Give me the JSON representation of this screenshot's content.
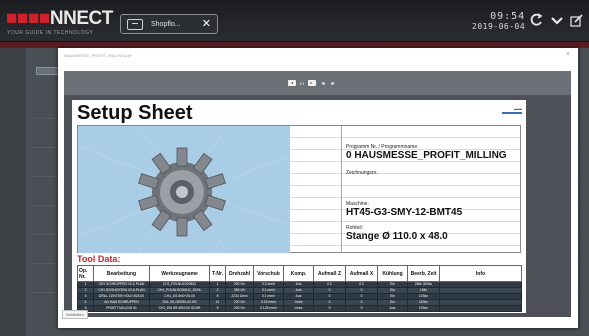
{
  "header": {
    "logo_red": "NNECT",
    "logo_red_prefix": "",
    "tagline": "YOUR GUIDE IN TECHNOLOGY",
    "tab_label": "Shopflo...",
    "tab_close": "✕",
    "time": "09:54",
    "date": "2019-06-04",
    "icons": [
      "refresh-icon",
      "chevron-down-icon",
      "edit-icon"
    ]
  },
  "modal": {
    "title": "HAUSMESSE_PROFIT_MILLING.pdf",
    "close": "×",
    "pager": {
      "prev": "◂",
      "page": "1/1",
      "next": "▸"
    },
    "close_button": "Schließen"
  },
  "sheet": {
    "title": "Setup Sheet",
    "program_label": "Programm Nr. / Programmname:",
    "program_value": "0 HAUSMESSE_PROFIT_MILLING",
    "drawing_label": "Zeichnungsnr.:",
    "machine_label": "Maschine:",
    "machine_value": "HT45-G3-SMY-12-BMT45",
    "stock_label": "Rohteil:",
    "stock_value": "Stange Ø 110.0 x  48.0",
    "tool_data_title": "Tool Data:"
  },
  "tool_table": {
    "headers": [
      "Op. Nr.",
      "Bearbeitung",
      "Werkzeugname",
      "T-Nr.",
      "Drehzahl",
      "Vorschub",
      "Komp.",
      "Aufmaß Z",
      "Aufmaß X",
      "Kühlung",
      "Beerb. Zeit",
      "Info"
    ],
    "rows": [
      [
        "1",
        "CH1 SCHRUPPEN V2 & PLAN",
        "CH1_POLNLSO20612",
        "1",
        "200 V/c",
        "0.2 mm/r",
        "Aus",
        "0.1",
        "0.2",
        "Ein",
        "2Min 30Sec",
        ""
      ],
      [
        "2",
        "CH1 SCHLICHTEN V2 & PLAN",
        "CH1_POLNLSO20612_SCHL",
        "2",
        "350 V/c",
        "0.1 mm/r",
        "Aus",
        "0",
        "0",
        "Ein",
        "1Min",
        ""
      ],
      [
        "3",
        "DRILL CENTER HOLE Ø25.00",
        "CH1_DS Ø40+25.00",
        "8",
        "2234 1/min",
        "0.1 mm/r",
        "Aus",
        "0",
        "0",
        "Ein",
        "10Sec",
        ""
      ],
      [
        "4",
        "AD HAM SCHRUPPEN",
        "SUL-XS-GRZ50-02-HS",
        "11",
        "220 V/c",
        "0.15 mm/r",
        "Links",
        "0",
        "0",
        "Ein",
        "11Sec",
        ""
      ],
      [
        "5",
        "PROFIT MILLING #1",
        "CH1_EM Ø4+Ø10.00 SCHR",
        "5",
        "200 V/c",
        "0.125 mm/r",
        "Links",
        "0",
        "0",
        "Aus",
        "10Sec",
        ""
      ]
    ]
  },
  "colors": {
    "brand_red": "#d0202a",
    "tool_title": "#c0282e",
    "row_dark": "#2f3a45"
  }
}
